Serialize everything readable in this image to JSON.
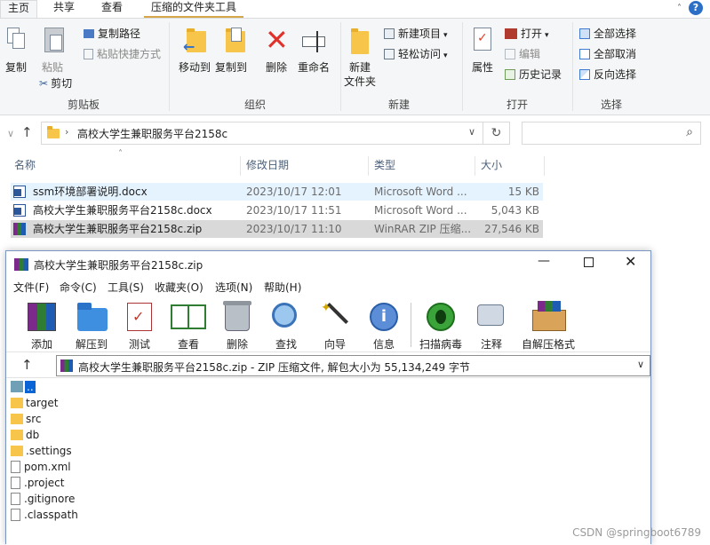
{
  "explorer": {
    "tabs": [
      "主页",
      "共享",
      "查看",
      "压缩的文件夹工具"
    ],
    "help": "?",
    "ribbon": {
      "clipboard": {
        "copy": "复制",
        "paste": "粘贴",
        "copy_path": "复制路径",
        "paste_shortcut": "粘贴快捷方式",
        "cut": "剪切",
        "label": "剪贴板"
      },
      "organize": {
        "move_to": "移动到",
        "copy_to": "复制到",
        "delete": "删除",
        "rename": "重命名",
        "label": "组织"
      },
      "new": {
        "new_folder": "新建\n文件夹",
        "new_folder_l1": "新建",
        "new_folder_l2": "文件夹",
        "new_item": "新建项目",
        "easy_access": "轻松访问",
        "label": "新建"
      },
      "open": {
        "properties": "属性",
        "open": "打开",
        "edit": "编辑",
        "history": "历史记录",
        "label": "打开"
      },
      "select": {
        "select_all": "全部选择",
        "select_none": "全部取消",
        "invert": "反向选择",
        "label": "选择"
      }
    },
    "address": {
      "path": "高校大学生兼职服务平台2158c"
    },
    "columns": [
      "名称",
      "修改日期",
      "类型",
      "大小"
    ],
    "files": [
      {
        "name": "ssm环境部署说明.docx",
        "date": "2023/10/17 12:01",
        "type": "Microsoft Word ...",
        "size": "15 KB",
        "icon": "word-icon"
      },
      {
        "name": "高校大学生兼职服务平台2158c.docx",
        "date": "2023/10/17 11:51",
        "type": "Microsoft Word ...",
        "size": "5,043 KB",
        "icon": "word-icon"
      },
      {
        "name": "高校大学生兼职服务平台2158c.zip",
        "date": "2023/10/17 11:10",
        "type": "WinRAR ZIP 压缩...",
        "size": "27,546 KB",
        "icon": "winrar-icon"
      }
    ]
  },
  "winrar": {
    "title": "高校大学生兼职服务平台2158c.zip",
    "menu": [
      "文件(F)",
      "命令(C)",
      "工具(S)",
      "收藏夹(O)",
      "选项(N)",
      "帮助(H)"
    ],
    "toolbar": [
      "添加",
      "解压到",
      "测试",
      "查看",
      "删除",
      "查找",
      "向导",
      "信息",
      "扫描病毒",
      "注释",
      "自解压格式"
    ],
    "path": "高校大学生兼职服务平台2158c.zip - ZIP 压缩文件, 解包大小为 55,134,249 字节",
    "entries": [
      {
        "name": "..",
        "kind": "up"
      },
      {
        "name": "target",
        "kind": "folder"
      },
      {
        "name": "src",
        "kind": "folder"
      },
      {
        "name": "db",
        "kind": "folder"
      },
      {
        "name": ".settings",
        "kind": "folder"
      },
      {
        "name": "pom.xml",
        "kind": "file"
      },
      {
        "name": ".project",
        "kind": "file"
      },
      {
        "name": ".gitignore",
        "kind": "file"
      },
      {
        "name": ".classpath",
        "kind": "file"
      }
    ]
  },
  "watermark": "CSDN @springboot6789"
}
